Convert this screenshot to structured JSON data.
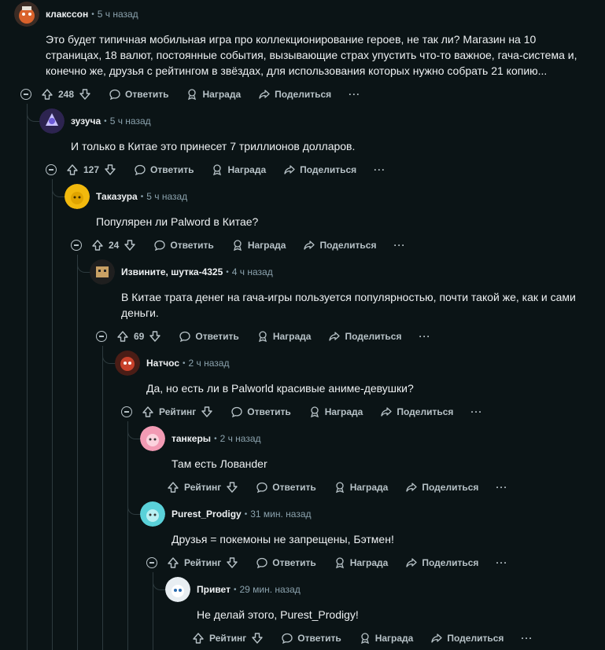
{
  "comments": [
    {
      "author": "клакссон",
      "time": "5 ч назад",
      "body": "Это будет типичная мобильная игра про коллекционирование героев, не так ли? Магазин на 10 страницах, 18 валют, постоянные события, вызывающие страх упустить что-то важное, гача-система и, конечно же, друзья с рейтингом в звёздах, для использования которых нужно собрать 21 копию...",
      "score": "248"
    },
    {
      "author": "зузуча",
      "time": "5 ч назад",
      "body": "И только в Китае это принесет 7 триллионов долларов.",
      "score": "127"
    },
    {
      "author": "Таказура",
      "time": "5 ч назад",
      "body": "Популярен ли Palword в Китае?",
      "score": "24"
    },
    {
      "author": "Извините, шутка-4325",
      "time": "4 ч назад",
      "body": "В Китае трата денег на гача-игры пользуется популярностью, почти такой же, как и сами деньги.",
      "score": "69"
    },
    {
      "author": "Натчос",
      "time": "2 ч назад",
      "body": "Да, но есть ли в Palworld красивые аниме-девушки?",
      "score": "Рейтинг"
    },
    {
      "author": "танкеры",
      "time": "2 ч назад",
      "body": "Там есть Лованder",
      "score": "Рейтинг"
    },
    {
      "author": "Purest_Prodigy",
      "time": "31 мин. назад",
      "body": "Друзья = покемоны не запрещены, Бэтмен!",
      "score": "Рейтинг"
    },
    {
      "author": "Привет",
      "time": "29 мин. назад",
      "body": "Не делай этого, Purest_Prodigy!",
      "score": "Рейтинг"
    }
  ],
  "actions": {
    "reply": "Ответить",
    "award": "Награда",
    "share": "Поделиться",
    "more": "···"
  },
  "colors": {
    "background": "#0b1416",
    "line": "#2d3a3e",
    "muted": "#8ba2ad"
  }
}
